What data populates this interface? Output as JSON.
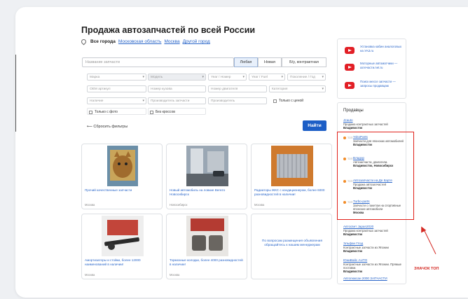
{
  "page": {
    "title": "Продажа автозапчастей по всей России"
  },
  "location": {
    "all": "Все города",
    "links": [
      "Московская область",
      "Москва",
      "Другой город"
    ]
  },
  "search": {
    "placeholder": "Название запчасти"
  },
  "condition_toggle": [
    "Любая",
    "Новая",
    "Б/у, контрактная"
  ],
  "filters": {
    "row1": [
      "Марка",
      "Модель",
      "Year / Номер",
      "Year / Fuel",
      "Поколение / Год"
    ],
    "row2": [
      "OEM артикул",
      "Номер кузова",
      "Номер двигателя",
      "Категория"
    ],
    "row3": [
      "Наличие",
      "Производитель запчасти",
      "Производитель"
    ],
    "check_price": "Только с ценой",
    "check_photo": "Только с фото",
    "check_nocross": "Без кроссов"
  },
  "actions": {
    "reset": "Сбросить фильтры",
    "find": "Найти"
  },
  "products": [
    {
      "title": "Прочий качественные запчасти",
      "city": "Москва"
    },
    {
      "title": "Новый автомобиль на ловкие Berezo Новосибирск",
      "city": "Новосибирск"
    },
    {
      "title": "Радиаторы ЖКС с кондиционером, более 6000 разновидностей в наличии!",
      "city": "Москва"
    },
    {
      "title": "Амортизаторы и стойки, более 12000 наименований в наличии!",
      "city": "Москва"
    },
    {
      "title": "Тормозные колодки, более 4000 разновидностей в наличии!",
      "city": "Москва"
    }
  ],
  "info_card": {
    "text": "По вопросам размещения объявления обращайтесь к нашим менеджерам"
  },
  "ads": [
    "Установка кабин аналоговых на УАЗ.ru",
    "Моторные автоматчики — азтечасти.net.ru",
    "Поиск мессе запчасти — запросы продавцам"
  ],
  "sellers": {
    "header": "Продавцы",
    "top_label": "ТОП",
    "pre": [
      {
        "name": "Jzauto",
        "desc": "Продажа контрактных запчастей",
        "city": "Владивосток"
      }
    ],
    "top": [
      {
        "name": "YokoParts",
        "desc": "Запчасти для японских автомобилей",
        "city": "Владивосток"
      },
      {
        "name": "Владэр",
        "desc": "Автозапчасти, двигатели.",
        "city": "Владивосток, Новосибирск"
      },
      {
        "name": "Автозапчасти на Де Карте",
        "desc": "Продажа автозапчастей",
        "city": "Владивосток"
      },
      {
        "name": "Turbo-parts",
        "desc": "Запчасти с пакетом на спортивные японские автомобили",
        "city": "Москва"
      }
    ],
    "post": [
      {
        "name": "Автосвет Japan2020",
        "desc": "Продажа контрактных запчастей",
        "city": "Владивосток"
      },
      {
        "name": "Эльфан Глэд",
        "desc": "Контрактные запчасти из Японии",
        "city": "Владивосток"
      },
      {
        "name": "ЮниВойс AUTO",
        "desc": "Контрактные запчасти из Японии. Прямые поставки.",
        "city": "Владивосток"
      },
      {
        "name": "Автолюксан 2000 ЗАПЧАСТИ",
        "desc": "",
        "city": ""
      }
    ]
  },
  "annotation": {
    "label": "ЗНАЧОК ТОП"
  }
}
